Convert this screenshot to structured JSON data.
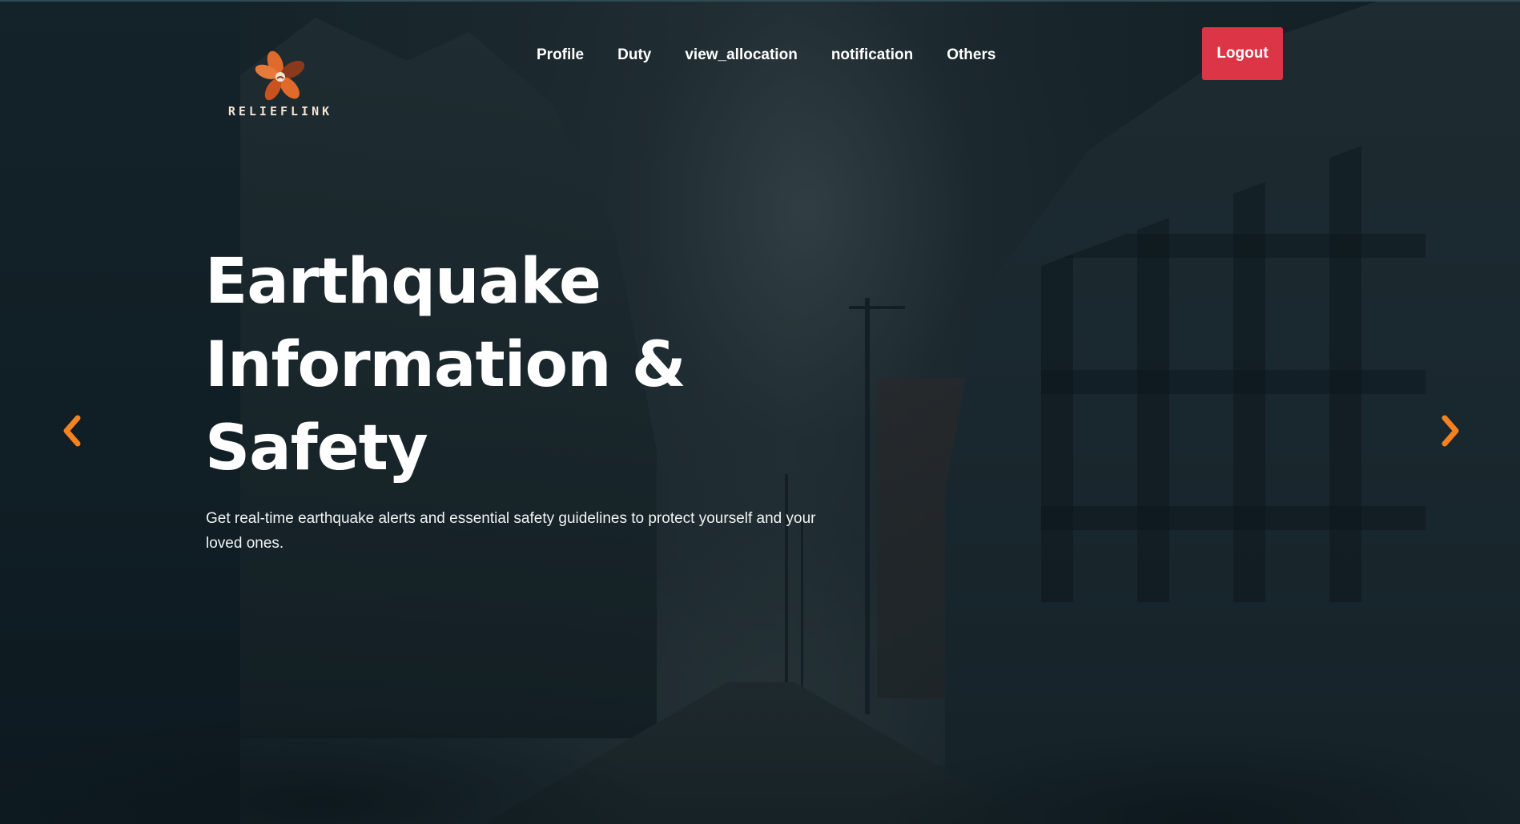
{
  "brand": {
    "logo_text": "RELIEFLINK",
    "logo_colors": [
      "#e06a2c",
      "#8a3a1c",
      "#f2e4d4"
    ]
  },
  "nav": {
    "items": [
      {
        "label": "Profile"
      },
      {
        "label": "Duty"
      },
      {
        "label": "view_allocation"
      },
      {
        "label": "notification"
      },
      {
        "label": "Others"
      }
    ],
    "logout_label": "Logout",
    "logout_color": "#dc3545"
  },
  "hero": {
    "title_line1": "Earthquake",
    "title_line2": "Information &",
    "title_line3": "Safety",
    "subtitle": "Get real-time earthquake alerts and essential safety guidelines to protect yourself and your loved ones.",
    "background_icon": "collapsed-buildings-street-photo"
  },
  "carousel": {
    "prev_icon": "chevron-left-icon",
    "next_icon": "chevron-right-icon",
    "arrow_color": "#f58220"
  }
}
